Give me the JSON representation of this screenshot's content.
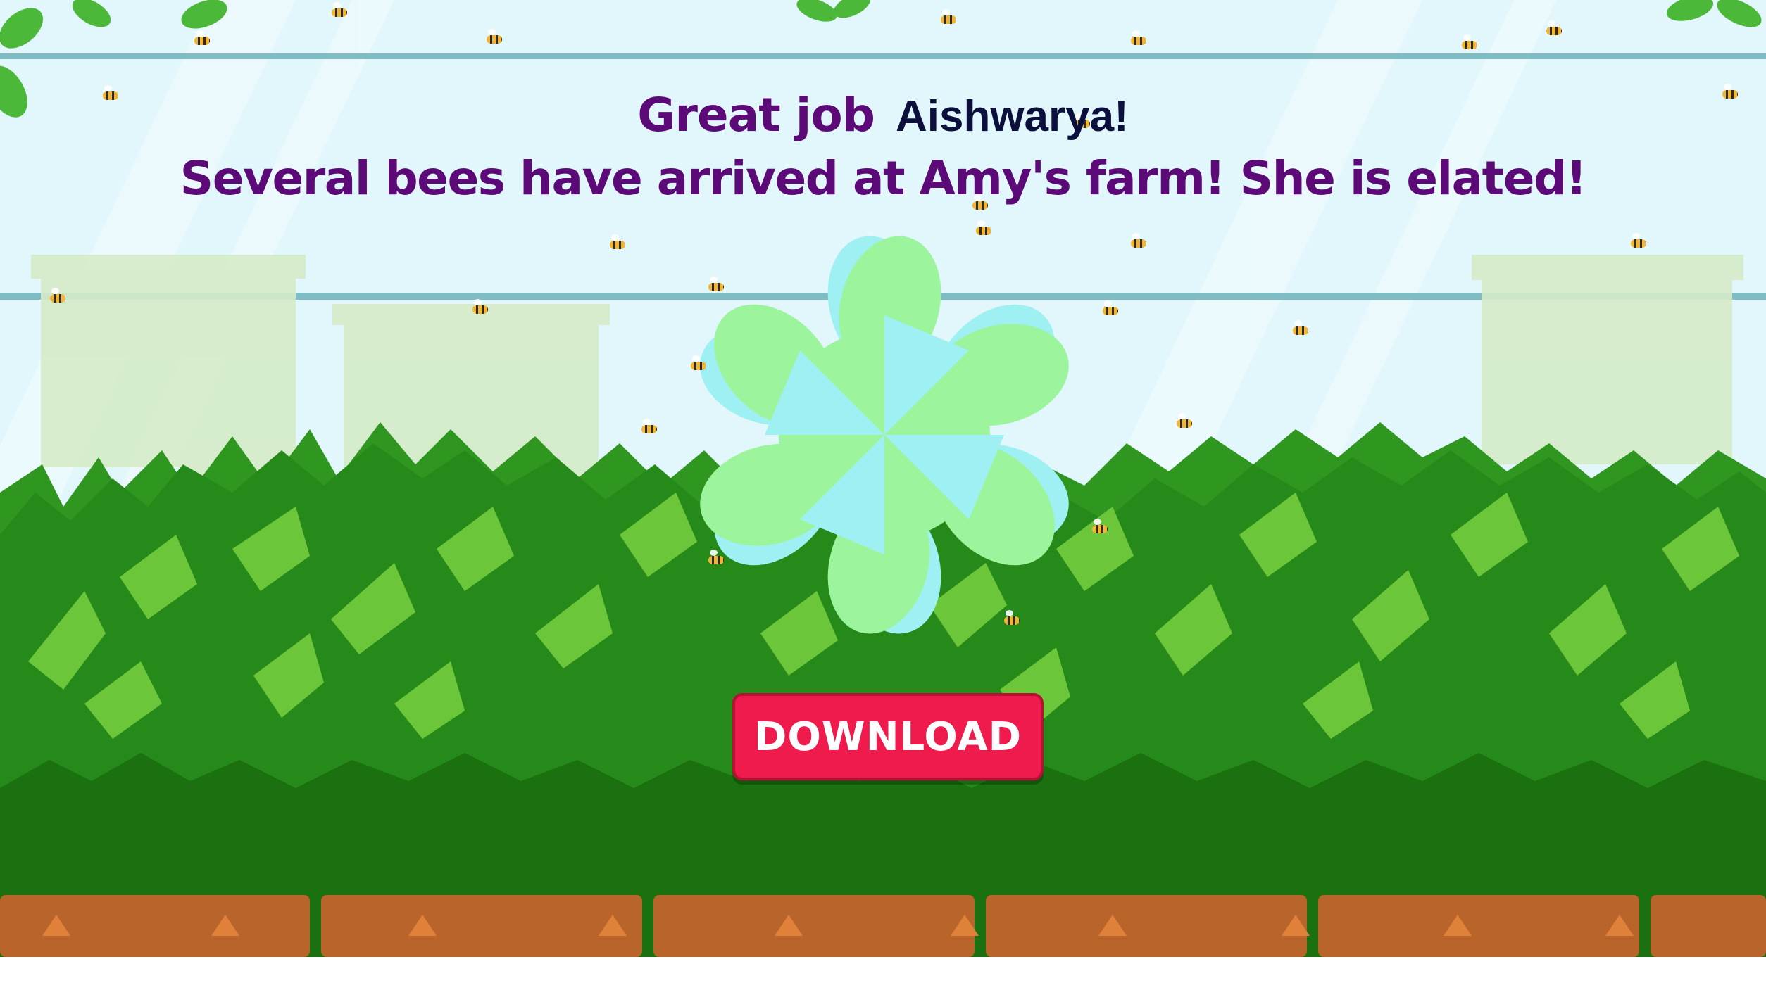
{
  "game": {
    "greeting": "Great job",
    "player_name": "Aishwarya!",
    "message": "Several bees have arrived at Amy's farm! She is elated!",
    "download_label": "DOWNLOAD"
  },
  "colors": {
    "sky": "#e1f7fb",
    "headline": "#5b0a78",
    "name": "#0b0f3b",
    "button": "#ef1b4c",
    "bush_light": "#6cc63a",
    "bush_mid": "#2a8d1a",
    "bush_dark": "#1a6e10",
    "soil": "#b8642a",
    "petal_green": "#9cf59c",
    "petal_blue": "#9ff0f3"
  },
  "icons": {
    "flower": "flower-icon",
    "bee": "bee-icon",
    "leaf": "leaf-icon"
  }
}
